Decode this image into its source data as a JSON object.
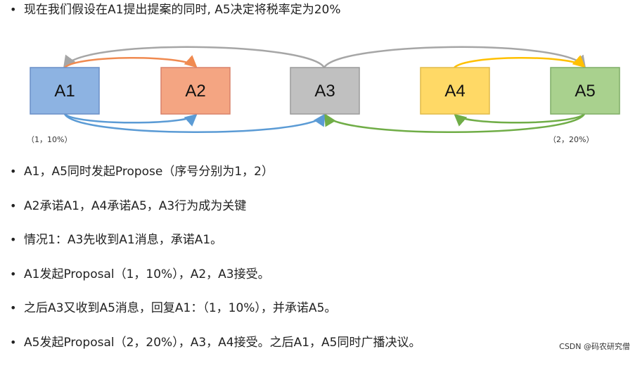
{
  "header": {
    "text": "现在我们假设在A1提出提案的同时, A5决定将税率定为20%"
  },
  "diagram": {
    "nodes": [
      {
        "id": "A1",
        "label": "A1",
        "fill": "#8db3e2",
        "stroke": "#6a8fc7"
      },
      {
        "id": "A2",
        "label": "A2",
        "fill": "#f4a582",
        "stroke": "#d9826a"
      },
      {
        "id": "A3",
        "label": "A3",
        "fill": "#c0c0c0",
        "stroke": "#9a9a9a"
      },
      {
        "id": "A4",
        "label": "A4",
        "fill": "#ffd966",
        "stroke": "#e0bb4a"
      },
      {
        "id": "A5",
        "label": "A5",
        "fill": "#a9d18e",
        "stroke": "#7fae66"
      }
    ],
    "proposal_a1": "（1，10%）",
    "proposal_a5": "（2，20%）",
    "colors": {
      "a1_a2": "#f08a50",
      "a1_a3": "#5b9bd5",
      "a5_a3": "#70ad47",
      "a5_a4": "#ffc000",
      "a3_broadcast": "#a6a6a6"
    }
  },
  "bullets": [
    "A1，A5同时发起Propose（序号分别为1，2）",
    "A2承诺A1，A4承诺A5，A3行为成为关键",
    "情况1：A3先收到A1消息，承诺A1。",
    "A1发起Proposal（1，10%），A2，A3接受。",
    "之后A3又收到A5消息，回复A1：（1，10%），并承诺A5。",
    "A5发起Proposal（2，20%），A3，A4接受。之后A1，A5同时广播决议。"
  ],
  "watermark": "CSDN @码农研究僧"
}
